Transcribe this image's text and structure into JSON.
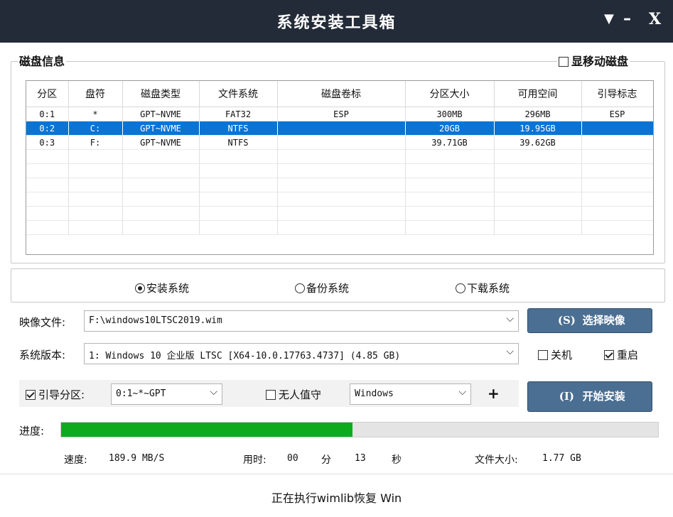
{
  "window": {
    "title": "系统安装工具箱",
    "menu_glyph": "▼",
    "minimize_glyph": "–",
    "close_glyph": "X"
  },
  "disk_info": {
    "group_title": "磁盘信息",
    "show_mobile_label": "显移动磁盘",
    "show_mobile_checked": false,
    "columns": [
      "分区",
      "盘符",
      "磁盘类型",
      "文件系统",
      "磁盘卷标",
      "分区大小",
      "可用空间",
      "引导标志"
    ],
    "rows": [
      [
        "0:1",
        "*",
        "GPT~NVME",
        "FAT32",
        "ESP",
        "300MB",
        "296MB",
        "ESP"
      ],
      [
        "0:2",
        "C:",
        "GPT~NVME",
        "NTFS",
        "",
        "20GB",
        "19.95GB",
        ""
      ],
      [
        "0:3",
        "F:",
        "GPT~NVME",
        "NTFS",
        "",
        "39.71GB",
        "39.62GB",
        ""
      ]
    ],
    "selected_row": 1,
    "empty_rows": 6
  },
  "modes": {
    "install": "安装系统",
    "backup": "备份系统",
    "download": "下载系统",
    "selected": "install"
  },
  "image": {
    "label": "映像文件:",
    "value": "F:\\windows10LTSC2019.wim",
    "select_button_key": "(S)",
    "select_button_label": "选择映像"
  },
  "version": {
    "label": "系统版本:",
    "value": "1: Windows 10 企业版 LTSC [X64-10.0.17763.4737] (4.85 GB)",
    "shutdown_label": "关机",
    "shutdown_checked": false,
    "restart_label": "重启",
    "restart_checked": true
  },
  "boot": {
    "boot_partition_label": "引导分区:",
    "boot_partition_checked": true,
    "boot_partition_value": "0:1~*~GPT",
    "unattended_label": "无人值守",
    "unattended_checked": false,
    "unattended_value": "Windows",
    "plus_label": "+",
    "start_button_key": "(I)",
    "start_button_label": "开始安装"
  },
  "progress": {
    "label": "进度:",
    "fraction": 0.488
  },
  "stats": {
    "speed_label": "速度:",
    "speed_value": "189.9 MB/S",
    "time_label": "用时:",
    "minutes": "00",
    "minutes_unit": "分",
    "seconds": "13",
    "seconds_unit": "秒",
    "size_label": "文件大小:",
    "size_value": "1.77 GB"
  },
  "status_text": "正在执行wimlib恢复 Win",
  "colors": {
    "titlebar": "#232b38",
    "selection": "#0a74d6",
    "button": "#4b6f92",
    "progress": "#0eaa1e"
  }
}
